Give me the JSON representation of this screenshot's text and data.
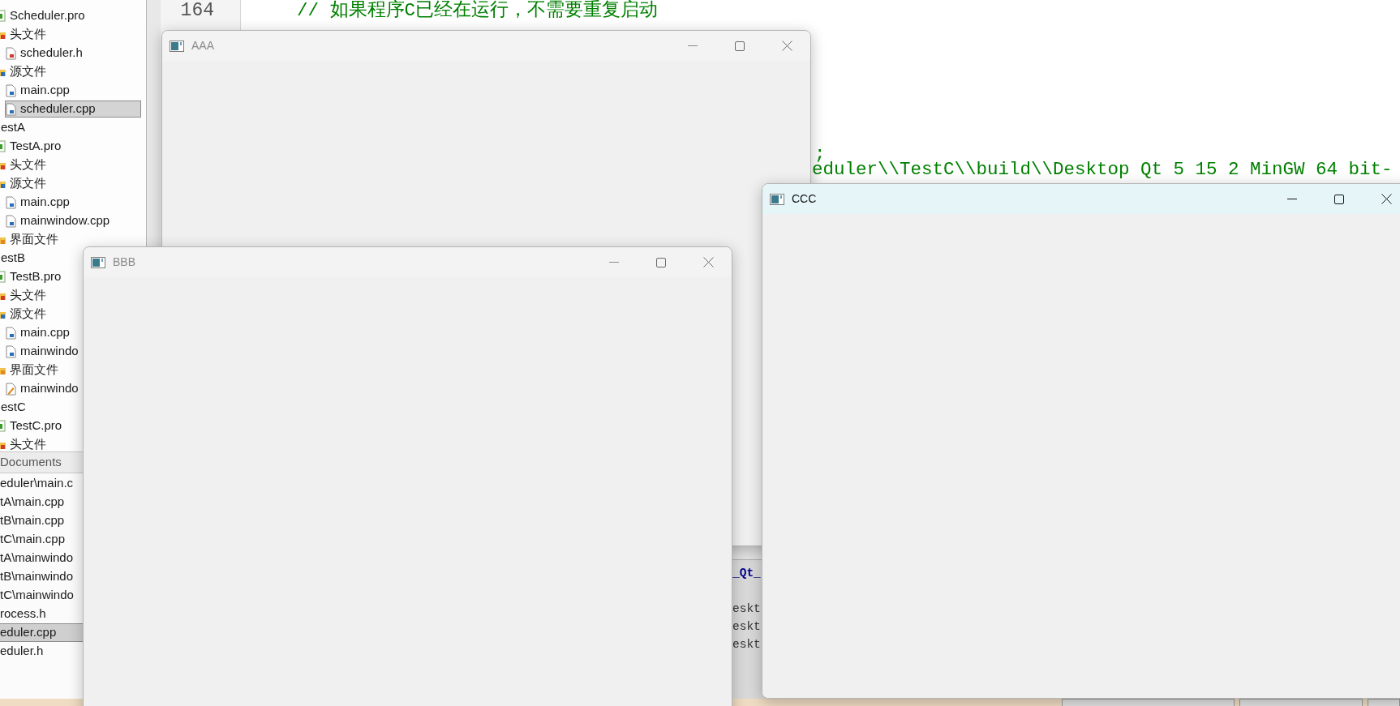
{
  "project_tree": [
    {
      "children": [
        {
          "label": "Scheduler.pro",
          "kind": "pro",
          "selected": false
        },
        {
          "label": "头文件",
          "kind": "header-folder",
          "selected": false,
          "children": [
            {
              "label": "scheduler.h",
              "kind": "h",
              "selected": false
            }
          ]
        },
        {
          "label": "源文件",
          "kind": "source-folder",
          "selected": false,
          "children": [
            {
              "label": "main.cpp",
              "kind": "cpp",
              "selected": false
            },
            {
              "label": "scheduler.cpp",
              "kind": "cpp",
              "selected": true
            }
          ]
        }
      ]
    },
    {
      "label": "estA",
      "selected": false,
      "children": [
        {
          "label": "TestA.pro",
          "kind": "pro",
          "selected": false
        },
        {
          "label": "头文件",
          "kind": "header-folder",
          "selected": false
        },
        {
          "label": "源文件",
          "kind": "source-folder",
          "selected": false,
          "children": [
            {
              "label": "main.cpp",
              "kind": "cpp",
              "selected": false
            },
            {
              "label": "mainwindow.cpp",
              "kind": "cpp",
              "selected": false
            }
          ]
        },
        {
          "label": "界面文件",
          "kind": "form-folder",
          "selected": false
        }
      ]
    },
    {
      "label": "estB",
      "selected": false,
      "children": [
        {
          "label": "TestB.pro",
          "kind": "pro",
          "selected": false
        },
        {
          "label": "头文件",
          "kind": "header-folder",
          "selected": false
        },
        {
          "label": "源文件",
          "kind": "source-folder",
          "selected": false,
          "children": [
            {
              "label": "main.cpp",
              "kind": "cpp",
              "selected": false
            },
            {
              "label": "mainwindo",
              "kind": "cpp",
              "selected": false
            }
          ]
        },
        {
          "label": "界面文件",
          "kind": "form-folder",
          "selected": false,
          "children": [
            {
              "label": "mainwindo",
              "kind": "ui",
              "selected": false
            }
          ]
        }
      ]
    },
    {
      "label": "estC",
      "selected": false,
      "children": [
        {
          "label": "TestC.pro",
          "kind": "pro",
          "selected": false
        },
        {
          "label": "头文件",
          "kind": "header-folder",
          "selected": false
        }
      ]
    }
  ],
  "open_documents": {
    "title": "Documents",
    "items": [
      {
        "label": "eduler\\main.c",
        "selected": false
      },
      {
        "label": "tA\\main.cpp",
        "selected": false
      },
      {
        "label": "tB\\main.cpp",
        "selected": false
      },
      {
        "label": "tC\\main.cpp",
        "selected": false
      },
      {
        "label": "tA\\mainwindo",
        "selected": false
      },
      {
        "label": "tB\\mainwindo",
        "selected": false
      },
      {
        "label": "tC\\mainwindo",
        "selected": false
      },
      {
        "label": "rocess.h",
        "selected": false
      },
      {
        "label": "eduler.cpp",
        "selected": true
      },
      {
        "label": "eduler.h",
        "selected": false
      }
    ]
  },
  "editor": {
    "line_number": "164",
    "lines": [
      "// 如果程序C已经在运行，不需要重复启动",
      ";",
      "eduler\\\\TestC\\\\build\\\\Desktop Qt 5 15 2 MinGW 64 bit-"
    ]
  },
  "output_pane": {
    "lines": [
      {
        "text": "_Qt_",
        "kind": "heading"
      },
      {
        "text": "eskt",
        "kind": "plain"
      },
      {
        "text": "eskt",
        "kind": "plain"
      },
      {
        "text": "eskt",
        "kind": "plain"
      }
    ]
  },
  "windows": [
    {
      "title": "AAA",
      "active": false
    },
    {
      "title": "BBB",
      "active": false
    },
    {
      "title": "CCC",
      "active": true
    }
  ]
}
